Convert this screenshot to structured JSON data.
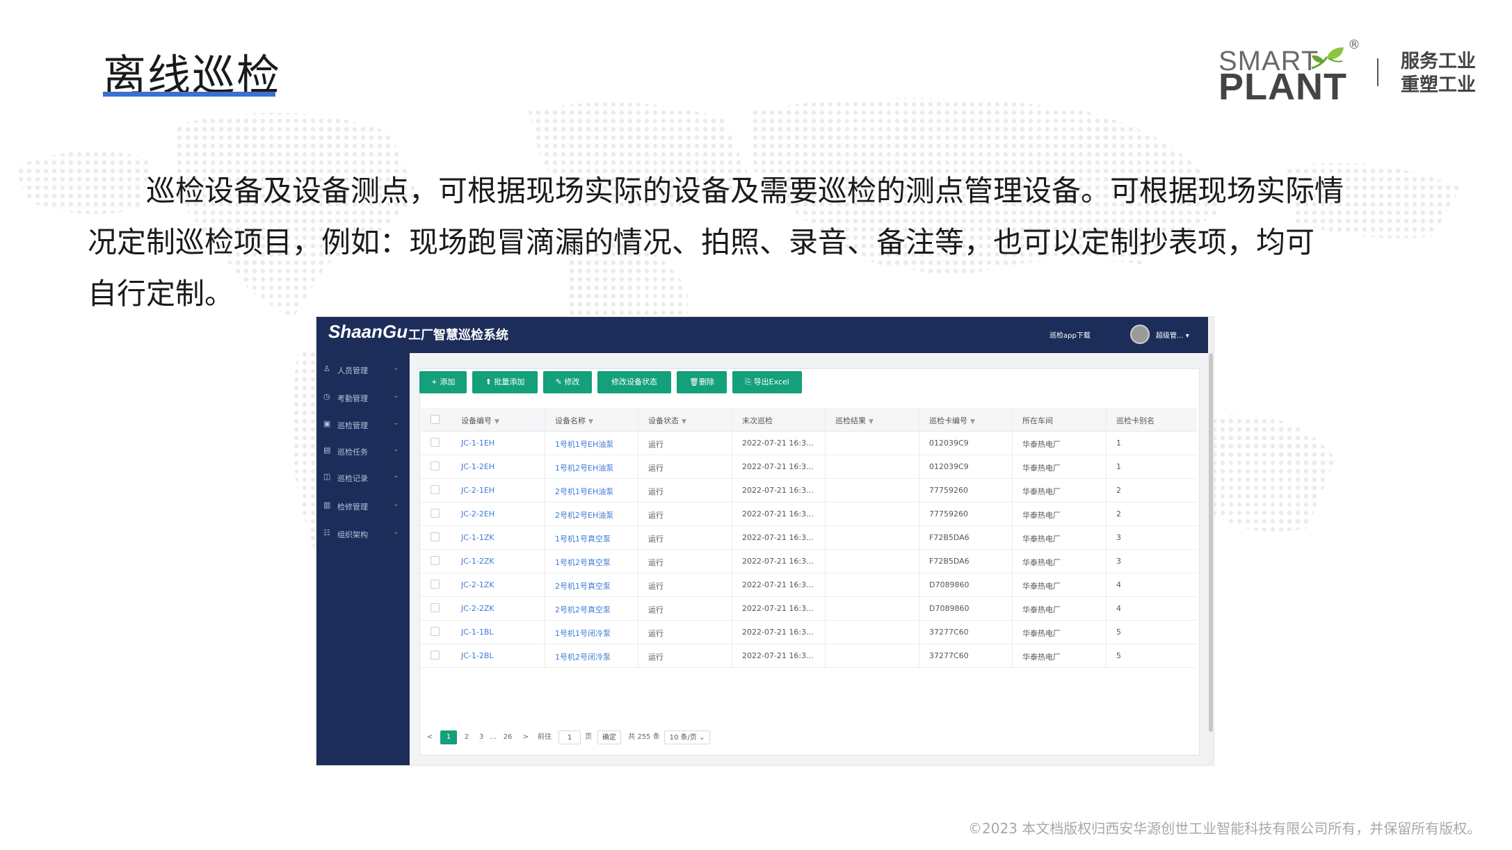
{
  "slide": {
    "title": "离线巡检",
    "paragraph_line1": "巡检设备及设备测点，可根据现场实际的设备及需要巡检的测点管理设备。可根据现场实际情",
    "paragraph_line2": "况定制巡检项目，例如：现场跑冒滴漏的情况、拍照、录音、备注等，也可以定制抄表项，均可",
    "paragraph_line3": "自行定制。",
    "footer": "©2023 本文档版权归西安华源创世工业智能科技有限公司所有，并保留所有版权。"
  },
  "logo": {
    "smart": "SMART",
    "plant": "PLANT",
    "reg": "®",
    "slogan_line1": "服务工业",
    "slogan_line2": "重塑工业"
  },
  "app": {
    "brand": "ShaanGu",
    "system_name": "工厂智慧巡检系统",
    "app_download": "巡检app下载",
    "username": "超级管..."
  },
  "sidebar": {
    "items": [
      {
        "icon": "people-icon",
        "label": "人员管理"
      },
      {
        "icon": "clock-icon",
        "label": "考勤管理"
      },
      {
        "icon": "device-icon",
        "label": "巡检管理"
      },
      {
        "icon": "task-icon",
        "label": "巡检任务"
      },
      {
        "icon": "record-icon",
        "label": "巡检记录"
      },
      {
        "icon": "repair-icon",
        "label": "检修管理"
      },
      {
        "icon": "org-icon",
        "label": "组织架构"
      }
    ]
  },
  "toolbar": {
    "add": "+ 添加",
    "batch_add": "批量添加",
    "edit": "修改",
    "change_status": "修改设备状态",
    "delete": "删除",
    "export": "导出Excel"
  },
  "table": {
    "headers": [
      "设备编号",
      "设备名称",
      "设备状态",
      "末次巡检",
      "巡检结果",
      "巡检卡编号",
      "所在车间",
      "巡检卡别名"
    ],
    "rows": [
      [
        "JC-1-1EH",
        "1号机1号EH油泵",
        "运行",
        "2022-07-21 16:3...",
        "",
        "012039C9",
        "华泰热电厂",
        "1"
      ],
      [
        "JC-1-2EH",
        "1号机2号EH油泵",
        "运行",
        "2022-07-21 16:3...",
        "",
        "012039C9",
        "华泰热电厂",
        "1"
      ],
      [
        "JC-2-1EH",
        "2号机1号EH油泵",
        "运行",
        "2022-07-21 16:3...",
        "",
        "77759260",
        "华泰热电厂",
        "2"
      ],
      [
        "JC-2-2EH",
        "2号机2号EH油泵",
        "运行",
        "2022-07-21 16:3...",
        "",
        "77759260",
        "华泰热电厂",
        "2"
      ],
      [
        "JC-1-1ZK",
        "1号机1号真空泵",
        "运行",
        "2022-07-21 16:3...",
        "",
        "F72B5DA6",
        "华泰热电厂",
        "3"
      ],
      [
        "JC-1-2ZK",
        "1号机2号真空泵",
        "运行",
        "2022-07-21 16:3...",
        "",
        "F72B5DA6",
        "华泰热电厂",
        "3"
      ],
      [
        "JC-2-1ZK",
        "2号机1号真空泵",
        "运行",
        "2022-07-21 16:3...",
        "",
        "D7089860",
        "华泰热电厂",
        "4"
      ],
      [
        "JC-2-2ZK",
        "2号机2号真空泵",
        "运行",
        "2022-07-21 16:3...",
        "",
        "D7089860",
        "华泰热电厂",
        "4"
      ],
      [
        "JC-1-1BL",
        "1号机1号闭冷泵",
        "运行",
        "2022-07-21 16:3...",
        "",
        "37277C60",
        "华泰热电厂",
        "5"
      ],
      [
        "JC-1-2BL",
        "1号机2号闭冷泵",
        "运行",
        "2022-07-21 16:3...",
        "",
        "37277C60",
        "华泰热电厂",
        "5"
      ]
    ]
  },
  "pagination": {
    "prev": "<",
    "pages": [
      "1",
      "2",
      "3",
      "...",
      "26"
    ],
    "next": ">",
    "goto_label": "前往",
    "goto_value": "1",
    "page_unit": "页",
    "confirm": "确定",
    "total": "共 255 条",
    "page_size": "10 条/页 ⌄"
  }
}
